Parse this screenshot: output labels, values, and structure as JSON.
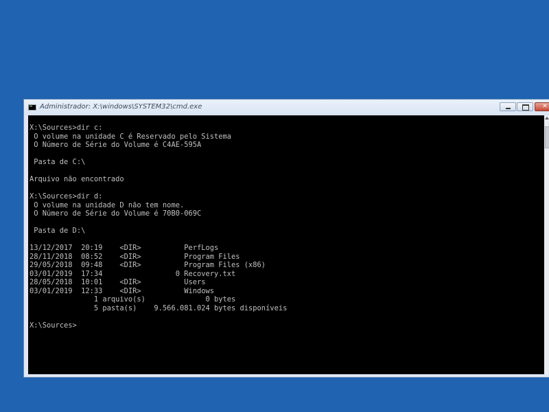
{
  "window": {
    "title": "Administrador: X:\\windows\\SYSTEM32\\cmd.exe",
    "icon": "console-icon",
    "controls": {
      "minimize_icon": "minimize-icon",
      "maximize_icon": "maximize-icon",
      "close_label": "✕"
    }
  },
  "console": {
    "lines": [
      "X:\\Sources>dir c:",
      " O volume na unidade C é Reservado pelo Sistema",
      " O Número de Série do Volume é C4AE-595A",
      "",
      " Pasta de C:\\",
      "",
      "Arquivo não encontrado",
      "",
      "X:\\Sources>dir d:",
      " O volume na unidade D não tem nome.",
      " O Número de Série do Volume é 70B0-069C",
      "",
      " Pasta de D:\\",
      "",
      "13/12/2017  20:19    <DIR>          PerfLogs",
      "28/11/2018  08:52    <DIR>          Program Files",
      "29/05/2018  09:48    <DIR>          Program Files (x86)",
      "03/01/2019  17:34                 0 Recovery.txt",
      "28/05/2018  10:01    <DIR>          Users",
      "03/01/2019  12:33    <DIR>          Windows",
      "               1 arquivo(s)              0 bytes",
      "               5 pasta(s)    9.566.081.024 bytes disponíveis",
      "",
      "X:\\Sources>"
    ]
  },
  "colors": {
    "desktop": "#1f63b1",
    "console_bg": "#000000",
    "console_fg": "#c0c0c0"
  }
}
